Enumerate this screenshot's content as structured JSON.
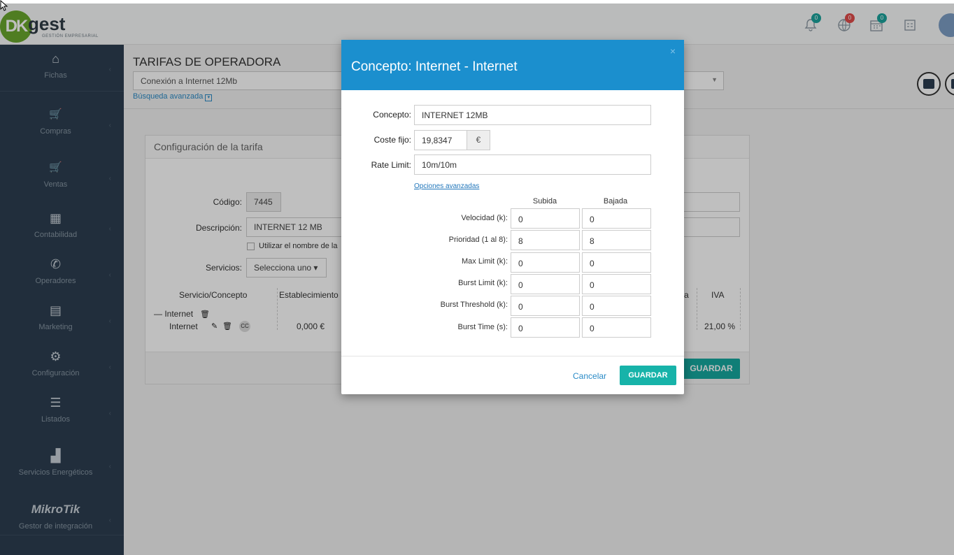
{
  "app": {
    "logo_text": "gest",
    "logo_mark": "DK",
    "logo_sub": "GESTIÓN EMPRESARIAL"
  },
  "header": {
    "badges": [
      {
        "icon": "bell-icon",
        "count": "0",
        "color": "#1ba39c"
      },
      {
        "icon": "globe-icon",
        "count": "0",
        "color": "#e04b4a"
      },
      {
        "icon": "calendar-icon",
        "count": "0",
        "color": "#1ba39c"
      }
    ]
  },
  "sidebar": {
    "items": [
      {
        "label": "Fichas",
        "icon": "home-icon",
        "glyph": "⌂"
      },
      {
        "label": "Compras",
        "icon": "cart-icon",
        "glyph": "🛒"
      },
      {
        "label": "Ventas",
        "icon": "cart-icon",
        "glyph": "🛒"
      },
      {
        "label": "Contabilidad",
        "icon": "calculator-icon",
        "glyph": "▦"
      },
      {
        "label": "Operadores",
        "icon": "phone-icon",
        "glyph": "✆"
      },
      {
        "label": "Marketing",
        "icon": "comment-icon",
        "glyph": "▤"
      },
      {
        "label": "Configuración",
        "icon": "gear-icon",
        "glyph": "⚙"
      },
      {
        "label": "Listados",
        "icon": "list-icon",
        "glyph": "☰"
      },
      {
        "label": "Servicios Energéticos",
        "icon": "factory-icon",
        "glyph": "▟"
      },
      {
        "label": "Gestor de integración",
        "icon": "mikrotik-logo",
        "glyph": "MikroTik"
      }
    ]
  },
  "page": {
    "title": "TARIFAS DE OPERADORA",
    "search_value": "Conexión a Internet 12Mb",
    "advanced_search": "Búsqueda avanzada"
  },
  "panel": {
    "title": "Configuración de la tarifa",
    "codigo_label": "Código:",
    "codigo_value": "7445",
    "descripcion_label": "Descripción:",
    "descripcion_value": "INTERNET 12 MB",
    "use_name_label": "Utilizar el nombre de la",
    "servicios_label": "Servicios:",
    "servicios_select": "Selecciona uno ▾",
    "table_headers": {
      "servicio": "Servicio/Concepto",
      "establecimiento": "Establecimiento",
      "hidden_col_suffix": "a",
      "iva": "IVA"
    },
    "group_name": "Internet",
    "row": {
      "concepto": "Internet",
      "establecimiento": "0,000 €",
      "iva": "21,00 %"
    },
    "cc_label": "CC",
    "save_button": "GUARDAR"
  },
  "modal": {
    "title": "Concepto: Internet - Internet",
    "concepto_label": "Concepto:",
    "concepto_value": "INTERNET 12MB",
    "coste_label": "Coste fijo:",
    "coste_value": "19,8347",
    "coste_addon": "€",
    "rate_label": "Rate Limit:",
    "rate_value": "10m/10m",
    "advanced_link": "Opciones avanzadas",
    "col_subida": "Subida",
    "col_bajada": "Bajada",
    "rows": [
      {
        "label": "Velocidad (k):",
        "subida": "0",
        "bajada": "0"
      },
      {
        "label": "Prioridad (1 al 8):",
        "subida": "8",
        "bajada": "8"
      },
      {
        "label": "Max Limit (k):",
        "subida": "0",
        "bajada": "0"
      },
      {
        "label": "Burst Limit (k):",
        "subida": "0",
        "bajada": "0"
      },
      {
        "label": "Burst Threshold (k):",
        "subida": "0",
        "bajada": "0"
      },
      {
        "label": "Burst Time (s):",
        "subida": "0",
        "bajada": "0"
      }
    ],
    "cancel": "Cancelar",
    "save": "GUARDAR"
  }
}
